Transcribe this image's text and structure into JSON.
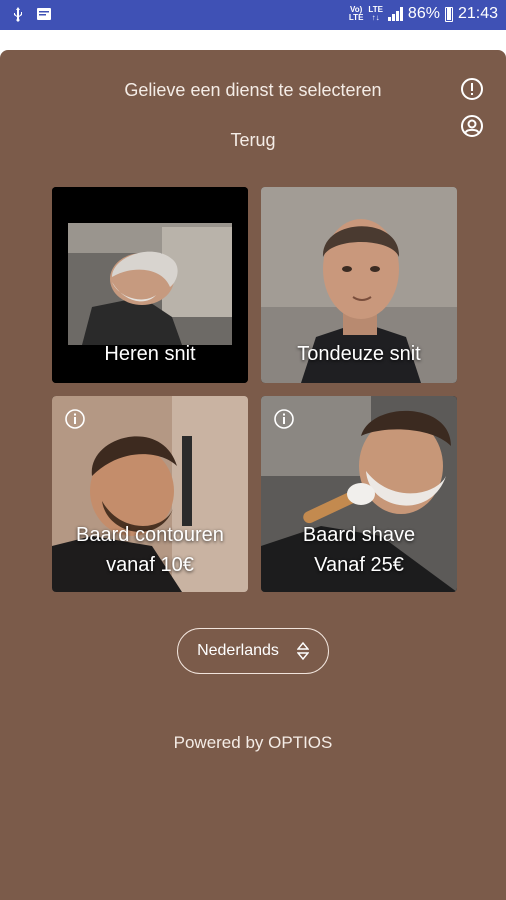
{
  "status_bar": {
    "network_top": "Vo)",
    "network_bottom": "LTE",
    "network2_top": "LTE",
    "network2_bottom": "↑↓",
    "battery": "86%",
    "time": "21:43"
  },
  "header": {
    "title": "Gelieve een dienst te selecteren",
    "back_label": "Terug"
  },
  "services": [
    {
      "label": "Heren snit",
      "has_info": false
    },
    {
      "label": "Tondeuze snit",
      "has_info": false
    },
    {
      "label_line1": "Baard contouren",
      "label_line2": "vanaf 10€",
      "has_info": true
    },
    {
      "label_line1": "Baard shave",
      "label_line2": "Vanaf 25€",
      "has_info": true
    }
  ],
  "language": {
    "selected": "Nederlands"
  },
  "footer": {
    "powered_by": "Powered by OPTIOS"
  },
  "colors": {
    "background": "#7b5b4a",
    "status_bar": "#3f51b5",
    "text": "#f4ece6"
  }
}
